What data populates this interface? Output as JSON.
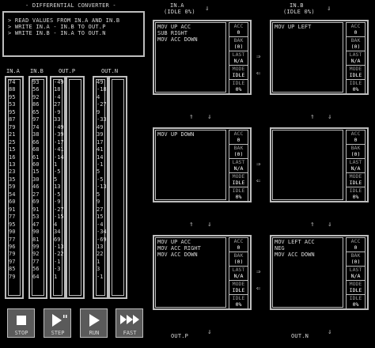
{
  "title": "- DIFFERENTIAL CONVERTER -",
  "description_lines": [
    "> READ VALUES FROM IN.A AND IN.B",
    "> WRITE IN.A - IN.B TO OUT.P",
    "> WRITE IN.B - IN.A TO OUT.N"
  ],
  "columns": {
    "in_a": {
      "label": "IN.A",
      "values": [
        "74",
        "88",
        "95",
        "53",
        "95",
        "87",
        "79",
        "21",
        "25",
        "15",
        "16",
        "13",
        "23",
        "35",
        "59",
        "54",
        "60",
        "91",
        "77",
        "95",
        "90",
        "77",
        "96",
        "79",
        "97",
        "85",
        "79"
      ]
    },
    "in_b": {
      "label": "IN.B",
      "values": [
        "93",
        "56",
        "92",
        "86",
        "65",
        "97",
        "74",
        "38",
        "66",
        "68",
        "61",
        "60",
        "15",
        "30",
        "46",
        "27",
        "69",
        "91",
        "53",
        "47",
        "90",
        "81",
        "99",
        "92",
        "77",
        "56",
        "64"
      ]
    },
    "out_p": {
      "label": "OUT.P",
      "values": [
        "-49",
        "18",
        "-4",
        "27",
        "-9",
        "33",
        "-49",
        "-39",
        "-17",
        "-41",
        "-14",
        "1",
        "-5",
        "5",
        "13",
        "-5",
        "-9",
        "-27",
        "-15",
        "4",
        "34",
        "69",
        "-13",
        "-22",
        "-1",
        "-3",
        "1"
      ]
    },
    "out_n": {
      "label": "OUT.N",
      "values": [
        "49",
        "-18",
        "4",
        "-27",
        "9",
        "-33",
        "49",
        "39",
        "17",
        "41",
        "14",
        "-1",
        "5",
        "-5",
        "-13",
        "5",
        "9",
        "27",
        "15",
        "-4",
        "-34",
        "-69",
        "13",
        "22",
        "1",
        "3",
        "-1"
      ]
    }
  },
  "nodes": {
    "input_a": {
      "label": "IN.A",
      "status": "(IDLE 0%)"
    },
    "input_b": {
      "label": "IN.B",
      "status": "(IDLE 0%)"
    },
    "output_p": {
      "label": "OUT.P"
    },
    "output_n": {
      "label": "OUT.N"
    },
    "n1": {
      "code": "MOV UP ACC\nSUB RIGHT\nMOV ACC DOWN",
      "acc": "0",
      "bak": "(0)",
      "last": "N/A",
      "mode": "IDLE",
      "idle": "0%"
    },
    "n2": {
      "code": "MOV UP LEFT",
      "acc": "0",
      "bak": "(0)",
      "last": "N/A",
      "mode": "IDLE",
      "idle": "0%"
    },
    "n3": {
      "code": "MOV UP DOWN",
      "acc": "0",
      "bak": "(0)",
      "last": "N/A",
      "mode": "IDLE",
      "idle": "0%"
    },
    "n4": {
      "code": "",
      "acc": "0",
      "bak": "(0)",
      "last": "N/A",
      "mode": "IDLE",
      "idle": "0%"
    },
    "n5": {
      "code": "MOV UP ACC\nMOV ACC RIGHT\nMOV ACC DOWN",
      "acc": "0",
      "bak": "(0)",
      "last": "N/A",
      "mode": "IDLE",
      "idle": "0%"
    },
    "n6": {
      "code": "MOV LEFT ACC\nNEG\nMOV ACC DOWN",
      "acc": "0",
      "bak": "(0)",
      "last": "N/A",
      "mode": "IDLE",
      "idle": "0%"
    }
  },
  "register_labels": {
    "acc": "ACC",
    "bak": "BAK",
    "last": "LAST",
    "mode": "MODE",
    "idle": "IDLE"
  },
  "buttons": {
    "stop": "STOP",
    "step": "STEP",
    "run": "RUN",
    "fast": "FAST"
  }
}
